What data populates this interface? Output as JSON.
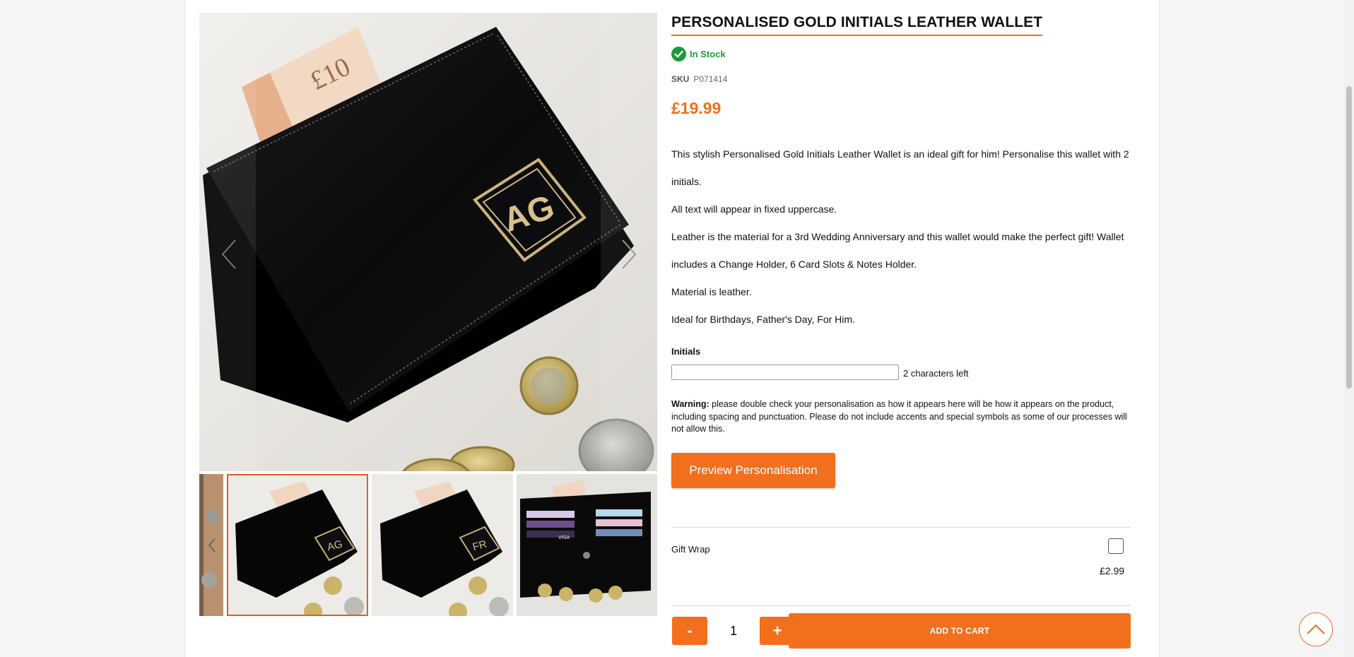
{
  "product": {
    "title": "PERSONALISED GOLD INITIALS LEATHER WALLET",
    "stock_status": "In Stock",
    "sku_label": "SKU",
    "sku": "P071414",
    "price": "£19.99",
    "description": [
      "This stylish Personalised Gold Initials Leather Wallet is an ideal gift for him! Personalise this wallet with 2 initials.",
      "All text will appear in fixed uppercase.",
      "Leather is the material for a 3rd Wedding Anniversary and this wallet would make the perfect gift! Wallet includes a Change Holder, 6 Card Slots & Notes Holder.",
      "Material is leather.",
      "Ideal for Birthdays, Father's Day, For Him."
    ]
  },
  "gallery": {
    "main_monogram": "AG",
    "thumbnails": [
      {
        "monogram": "AG"
      },
      {
        "monogram": "FR"
      },
      {
        "monogram": ""
      }
    ],
    "main_banknote_text": "£10",
    "thumb_card_text": "VISA"
  },
  "personalisation": {
    "initials_label": "Initials",
    "initials_value": "",
    "chars_left": "2 characters left",
    "warning_label": "Warning:",
    "warning_text": " please double check your personalisation as how it appears here will be how it appears on the product, including spacing and punctuation. Please do not include accents and special symbols as some of our processes will not allow this.",
    "preview_button": "Preview Personalisation"
  },
  "gift_wrap": {
    "label": "Gift Wrap",
    "price": "£2.99",
    "checked": false
  },
  "cart": {
    "minus": "-",
    "quantity": "1",
    "plus": "+",
    "add_to_cart": "ADD TO CART"
  },
  "colors": {
    "accent": "#f26f1d",
    "in_stock": "#1e9a3c",
    "selected_thumb_border": "#e95a1c"
  },
  "icons": {
    "stock": "check-circle-icon",
    "gallery_prev": "chevron-left-icon",
    "gallery_next": "chevron-right-icon",
    "scroll_top": "chevron-up-icon"
  }
}
